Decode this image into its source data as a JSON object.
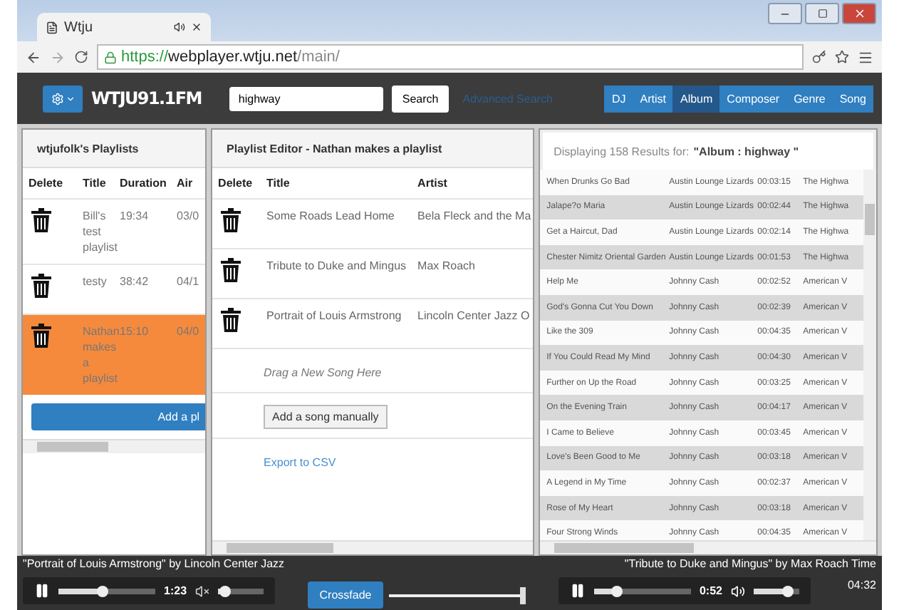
{
  "browser": {
    "tab_title": "Wtju",
    "url_secure": "https://",
    "url_host": "webplayer.wtju.net",
    "url_path": "/main/"
  },
  "header": {
    "logo": "WTJU91.1FM",
    "search_value": "highway",
    "search_button": "Search",
    "advanced_link": "Advanced Search",
    "filters": [
      {
        "label": "DJ",
        "selected": false
      },
      {
        "label": "Artist",
        "selected": false
      },
      {
        "label": "Album",
        "selected": true
      },
      {
        "label": "Composer",
        "selected": false
      },
      {
        "label": "Genre",
        "selected": false
      },
      {
        "label": "Song",
        "selected": false
      }
    ]
  },
  "playlists": {
    "title": "wtjufolk's Playlists",
    "columns": [
      "Delete",
      "Title",
      "Duration",
      "Air"
    ],
    "rows": [
      {
        "title": "Bill's test playlist",
        "duration": "19:34",
        "air": "03/0",
        "selected": false
      },
      {
        "title": "testy",
        "duration": "38:42",
        "air": "04/1",
        "selected": false
      },
      {
        "title": "Nathan makes a playlist",
        "duration": "15:10",
        "air": "04/0",
        "selected": true
      }
    ],
    "add_button": "Add a pl"
  },
  "editor": {
    "title": "Playlist Editor - Nathan makes a playlist",
    "columns": [
      "Delete",
      "Title",
      "Artist"
    ],
    "rows": [
      {
        "title": "Some Roads Lead Home",
        "artist": "Bela Fleck and the Ma"
      },
      {
        "title": "Tribute to Duke and Mingus",
        "artist": "Max Roach"
      },
      {
        "title": "Portrait of Louis Armstrong",
        "artist": "Lincoln Center Jazz O"
      }
    ],
    "drop_hint": "Drag a New Song Here",
    "add_button": "Add a song manually",
    "export_link": "Export to CSV"
  },
  "results": {
    "prefix": "Displaying 158 Results for:",
    "query": "\"Album : highway \"",
    "rows": [
      {
        "title": "When Drunks Go Bad",
        "artist": "Austin Lounge Lizards",
        "time": "00:03:15",
        "album": "The Highwa"
      },
      {
        "title": "Jalape?o Maria",
        "artist": "Austin Lounge Lizards",
        "time": "00:02:44",
        "album": "The Highwa"
      },
      {
        "title": "Get a Haircut, Dad",
        "artist": "Austin Lounge Lizards",
        "time": "00:02:14",
        "album": "The Highwa"
      },
      {
        "title": "Chester Nimitz Oriental Garden",
        "artist": "Austin Lounge Lizards",
        "time": "00:01:53",
        "album": "The Highwa"
      },
      {
        "title": "Help Me",
        "artist": "Johnny Cash",
        "time": "00:02:52",
        "album": "American V"
      },
      {
        "title": "God's Gonna Cut You Down",
        "artist": "Johnny Cash",
        "time": "00:02:39",
        "album": "American V"
      },
      {
        "title": "Like the 309",
        "artist": "Johnny Cash",
        "time": "00:04:35",
        "album": "American V"
      },
      {
        "title": "If You Could Read My Mind",
        "artist": "Johnny Cash",
        "time": "00:04:30",
        "album": "American V"
      },
      {
        "title": "Further on Up the Road",
        "artist": "Johnny Cash",
        "time": "00:03:25",
        "album": "American V"
      },
      {
        "title": "On the Evening Train",
        "artist": "Johnny Cash",
        "time": "00:04:17",
        "album": "American V"
      },
      {
        "title": "I Came to Believe",
        "artist": "Johnny Cash",
        "time": "00:03:45",
        "album": "American V"
      },
      {
        "title": "Love's Been Good to Me",
        "artist": "Johnny Cash",
        "time": "00:03:18",
        "album": "American V"
      },
      {
        "title": "A Legend in My Time",
        "artist": "Johnny Cash",
        "time": "00:02:37",
        "album": "American V"
      },
      {
        "title": "Rose of My Heart",
        "artist": "Johnny Cash",
        "time": "00:03:18",
        "album": "American V"
      },
      {
        "title": "Four Strong Winds",
        "artist": "Johnny Cash",
        "time": "00:04:35",
        "album": "American V"
      }
    ]
  },
  "players": [
    {
      "caption": "\"Portrait of Louis Armstrong\" by Lincoln Center Jazz",
      "elapsed": "1:23",
      "level": 0.45,
      "volume": {
        "level": 0.05,
        "muted": true
      }
    },
    {
      "caption": "\"Tribute to Duke and Mingus\" by Max Roach Time",
      "remaining": "04:32",
      "elapsed": "0:52",
      "level": 0.2,
      "volume": {
        "level": 0.85,
        "muted": false
      }
    }
  ],
  "crossfade": {
    "label": "Crossfade",
    "level": 1
  }
}
